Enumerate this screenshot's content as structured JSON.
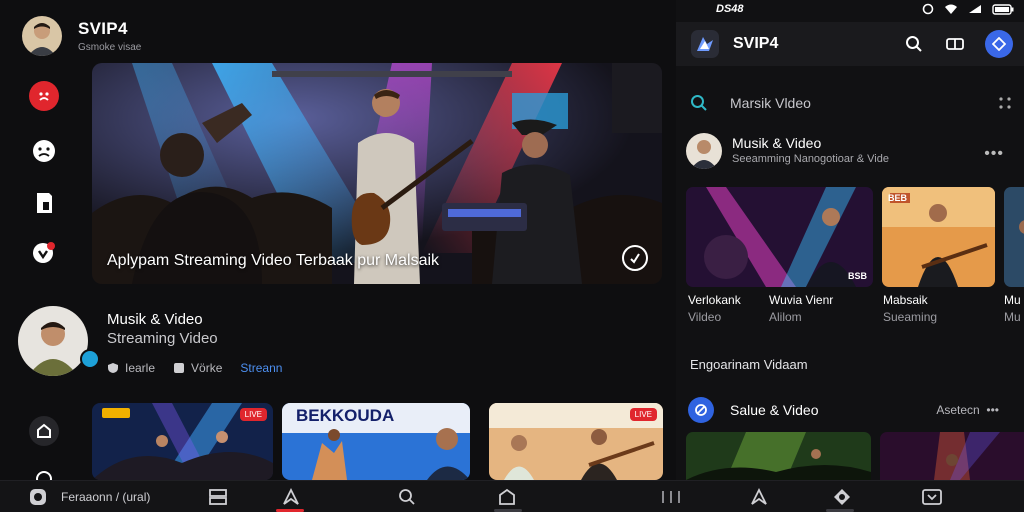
{
  "left": {
    "app": {
      "title": "SVIP4",
      "subtitle": "Gsmoke visae"
    },
    "hero": {
      "caption": "Aplypam Streaming Video Terbaak pur Malsaik"
    },
    "channel": {
      "title": "Musik & Video",
      "subtitle": "Streaming Video",
      "actions": [
        {
          "label": "Iearle",
          "icon": "shield-icon"
        },
        {
          "label": "Vörke",
          "icon": "square-icon"
        },
        {
          "label": "Streann",
          "icon": ""
        }
      ]
    },
    "thumb_badges": [
      "LIVE",
      "LIVE"
    ],
    "thumb_texts": [
      "DESIO",
      "BEKKOUDA"
    ]
  },
  "right": {
    "status": {
      "time": "DS48"
    },
    "topbar": {
      "title": "SVIP4"
    },
    "search": {
      "placeholder": "Marsik Vldeo"
    },
    "channel": {
      "title": "Musik & Video",
      "subtitle": "Seeamming Nanogotioar & Vide"
    },
    "cards": [
      {
        "title": "Verlokank",
        "sub": "Vildeo",
        "badge": "BSB"
      },
      {
        "title": "Wuvia Vienr",
        "sub": "Alilom",
        "badge": ""
      },
      {
        "title": "Mabsaik",
        "sub": "Sueaming",
        "badge": "BEB"
      },
      {
        "title": "Mu",
        "sub": "Mu",
        "badge": ""
      }
    ],
    "section_title": "Engoarinam Vidaam",
    "category": {
      "label": "Salue & Video",
      "more": "Asetecn"
    }
  },
  "bottom_nav": {
    "first_label": "Feraaonn / (ural)"
  },
  "colors": {
    "accent_red": "#e0262d",
    "accent_blue": "#3a68e8",
    "link_blue": "#4d8ff0",
    "background": "#0c0c0d"
  }
}
